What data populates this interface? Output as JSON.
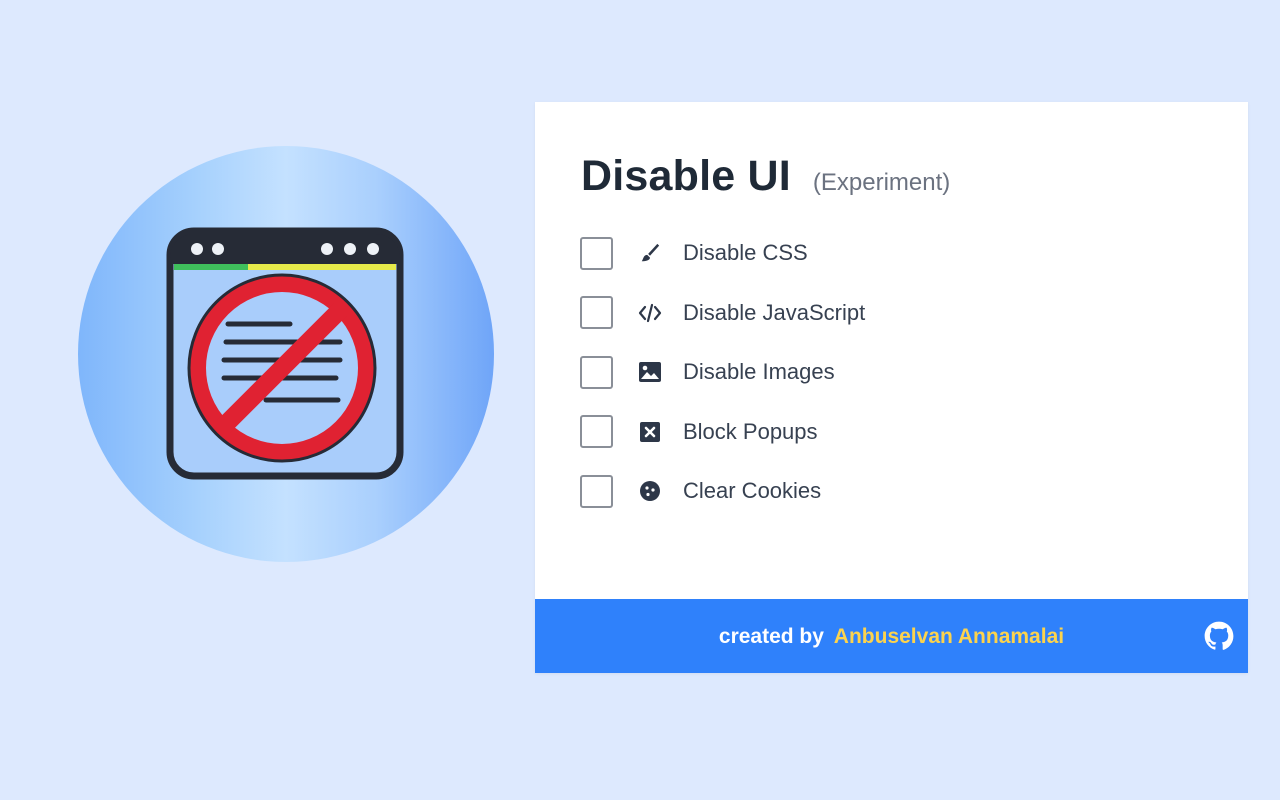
{
  "popup": {
    "title": "Disable UI",
    "subtitle": "(Experiment)",
    "options": [
      {
        "label": "Disable CSS",
        "icon": "paint-brush-icon",
        "checked": false
      },
      {
        "label": "Disable JavaScript",
        "icon": "code-icon",
        "checked": false
      },
      {
        "label": "Disable Images",
        "icon": "image-icon",
        "checked": false
      },
      {
        "label": "Block Popups",
        "icon": "close-window-icon",
        "checked": false
      },
      {
        "label": "Clear Cookies",
        "icon": "cookie-icon",
        "checked": false
      }
    ]
  },
  "footer": {
    "prefix": "created by",
    "author": "Anbuselvan Annamalai",
    "link_icon": "github-icon"
  },
  "colors": {
    "background": "#dde9fe",
    "footer": "#2f81fb",
    "author": "#fcd34d",
    "title": "#1f2a37",
    "icon": "#2d3748"
  }
}
